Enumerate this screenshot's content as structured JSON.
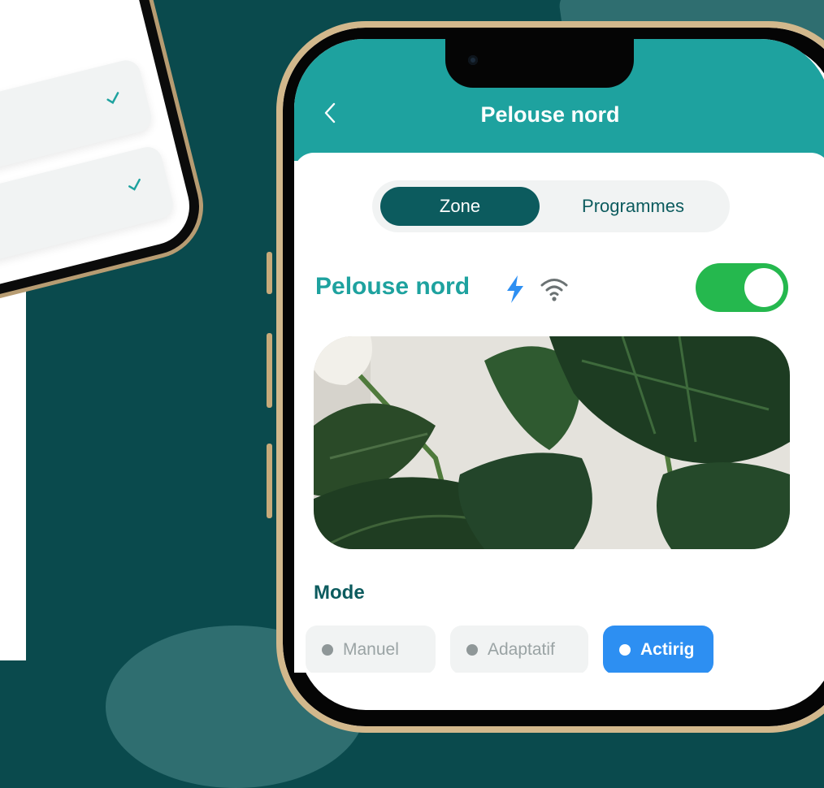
{
  "header": {
    "title": "Pelouse nord",
    "back_icon": "chevron-left-icon"
  },
  "tabs": [
    {
      "label": "Zone",
      "active": true
    },
    {
      "label": "Programmes",
      "active": false
    }
  ],
  "zone": {
    "name": "Pelouse nord",
    "status_icons": [
      "bolt-icon",
      "wifi-icon"
    ],
    "enabled": true
  },
  "mode": {
    "label": "Mode",
    "options": [
      {
        "label": "Manuel",
        "selected": false
      },
      {
        "label": "Adaptatif",
        "selected": false
      },
      {
        "label": "Actirig",
        "selected": true
      }
    ]
  },
  "colors": {
    "brand_teal": "#1ea29f",
    "dark_teal": "#0c5b5e",
    "toggle_on": "#25b84e",
    "active_mode": "#2d8ff2",
    "bolt": "#2d8ff2"
  }
}
